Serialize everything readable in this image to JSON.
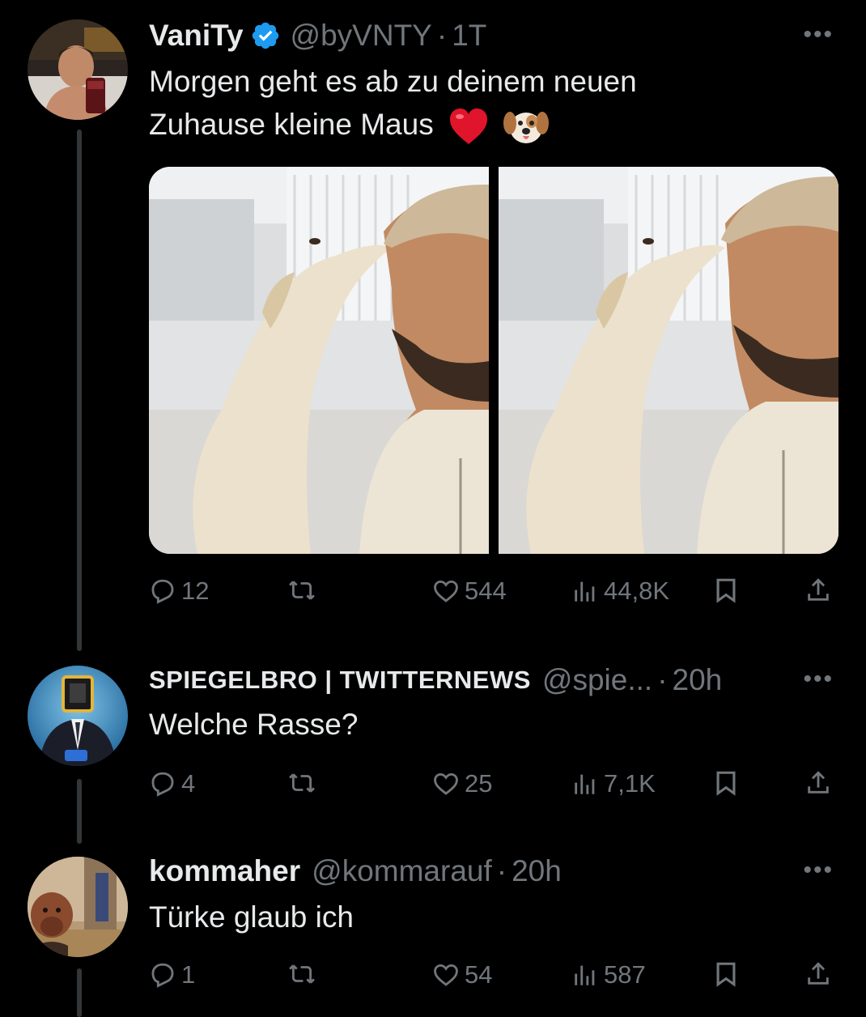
{
  "tweets": [
    {
      "name": "VaniTy",
      "verified": true,
      "handle": "@byVNTY",
      "sep": "·",
      "time": "1T",
      "text_line1": "Morgen geht es ab zu deinem neuen",
      "text_line2": "Zuhause kleine Maus",
      "emojis": [
        "heart-emoji",
        "dog-face-emoji"
      ],
      "actions": {
        "replies": "12",
        "retweets": "",
        "likes": "544",
        "views": "44,8K"
      }
    },
    {
      "name": "SPIEGELBRO | TWITTERNEWS",
      "verified": false,
      "handle": "@spie...",
      "sep": "·",
      "time": "20h",
      "text_line1": "Welche Rasse?",
      "actions": {
        "replies": "4",
        "retweets": "",
        "likes": "25",
        "views": "7,1K"
      }
    },
    {
      "name": "kommaher",
      "verified": false,
      "handle": "@kommarauf",
      "sep": "·",
      "time": "20h",
      "text_line1": "Türke glaub ich",
      "actions": {
        "replies": "1",
        "retweets": "",
        "likes": "54",
        "views": "587"
      }
    }
  ],
  "more_label": "•••",
  "colors": {
    "background": "#000000",
    "text": "#e7e9ea",
    "muted": "#71767b",
    "verified": "#1d9bf0",
    "thread_line": "#333639"
  }
}
